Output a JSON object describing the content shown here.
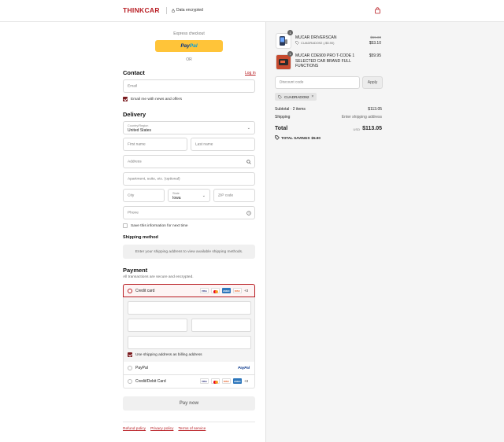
{
  "header": {
    "logo": "THINKCAR",
    "encrypted": "Data encrypted",
    "cart_icon": "shopping-bag-icon"
  },
  "express": {
    "label": "Express checkout",
    "paypal_a": "Pay",
    "paypal_b": "Pal",
    "or": "OR"
  },
  "contact": {
    "title": "Contact",
    "login": "Log in",
    "email_placeholder": "Email",
    "newsletter": "Email me with news and offers",
    "newsletter_checked": true
  },
  "delivery": {
    "title": "Delivery",
    "country_label": "Country/Region",
    "country_value": "United States",
    "first_name": "First name",
    "last_name": "Last name",
    "address": "Address",
    "apartment": "Apartment, suite, etc. (optional)",
    "city": "City",
    "state_label": "State",
    "state_value": "Iowa",
    "zip": "ZIP code",
    "phone": "Phone",
    "save_info": "Save this information for next time",
    "save_info_checked": false
  },
  "shipping_method": {
    "title": "Shipping method",
    "message": "Enter your shipping address to view available shipping methods."
  },
  "payment": {
    "title": "Payment",
    "subtitle": "All transactions are secure and encrypted.",
    "credit_card": "Credit card",
    "card_brands": [
      "VISA",
      "MC",
      "AMEX",
      "DISCOVER"
    ],
    "more": "+3",
    "billing_same": "Use shipping address as billing address",
    "billing_same_checked": true,
    "paypal": "PayPal",
    "paypal_logo": "PayPal",
    "debit": "Credit/Debit Card",
    "debit_more": "+3",
    "selected": "credit_card"
  },
  "pay_now": "Pay now",
  "footer": {
    "refund": "Refund policy",
    "privacy": "Privacy policy",
    "terms": "Terms of service"
  },
  "order": {
    "items": [
      {
        "qty": "1",
        "title": "MUCAR DRIVERSCAN",
        "discount": "CUADRADO92 (-$5.90)",
        "price_old": "$59.00",
        "price": "$53.10"
      },
      {
        "qty": "1",
        "title": "MUCAR CDE900 PRO T-CODE 1 SELECTED CAR BRAND FULL FUNCTIONS",
        "price": "$59.95"
      }
    ],
    "discount_placeholder": "Discount code",
    "apply": "Apply",
    "applied_code": "CUADRADO92",
    "subtotal_label": "Subtotal · 2 items",
    "subtotal": "$113.05",
    "shipping_label": "Shipping",
    "shipping_value": "Enter shipping address",
    "total_label": "Total",
    "currency": "USD",
    "total": "$113.05",
    "savings_label": "TOTAL SAVINGS",
    "savings": "$5.90"
  },
  "colors": {
    "brand": "#b81c22",
    "checkbox": "#7a1a1e",
    "paypal": "#ffc439"
  }
}
